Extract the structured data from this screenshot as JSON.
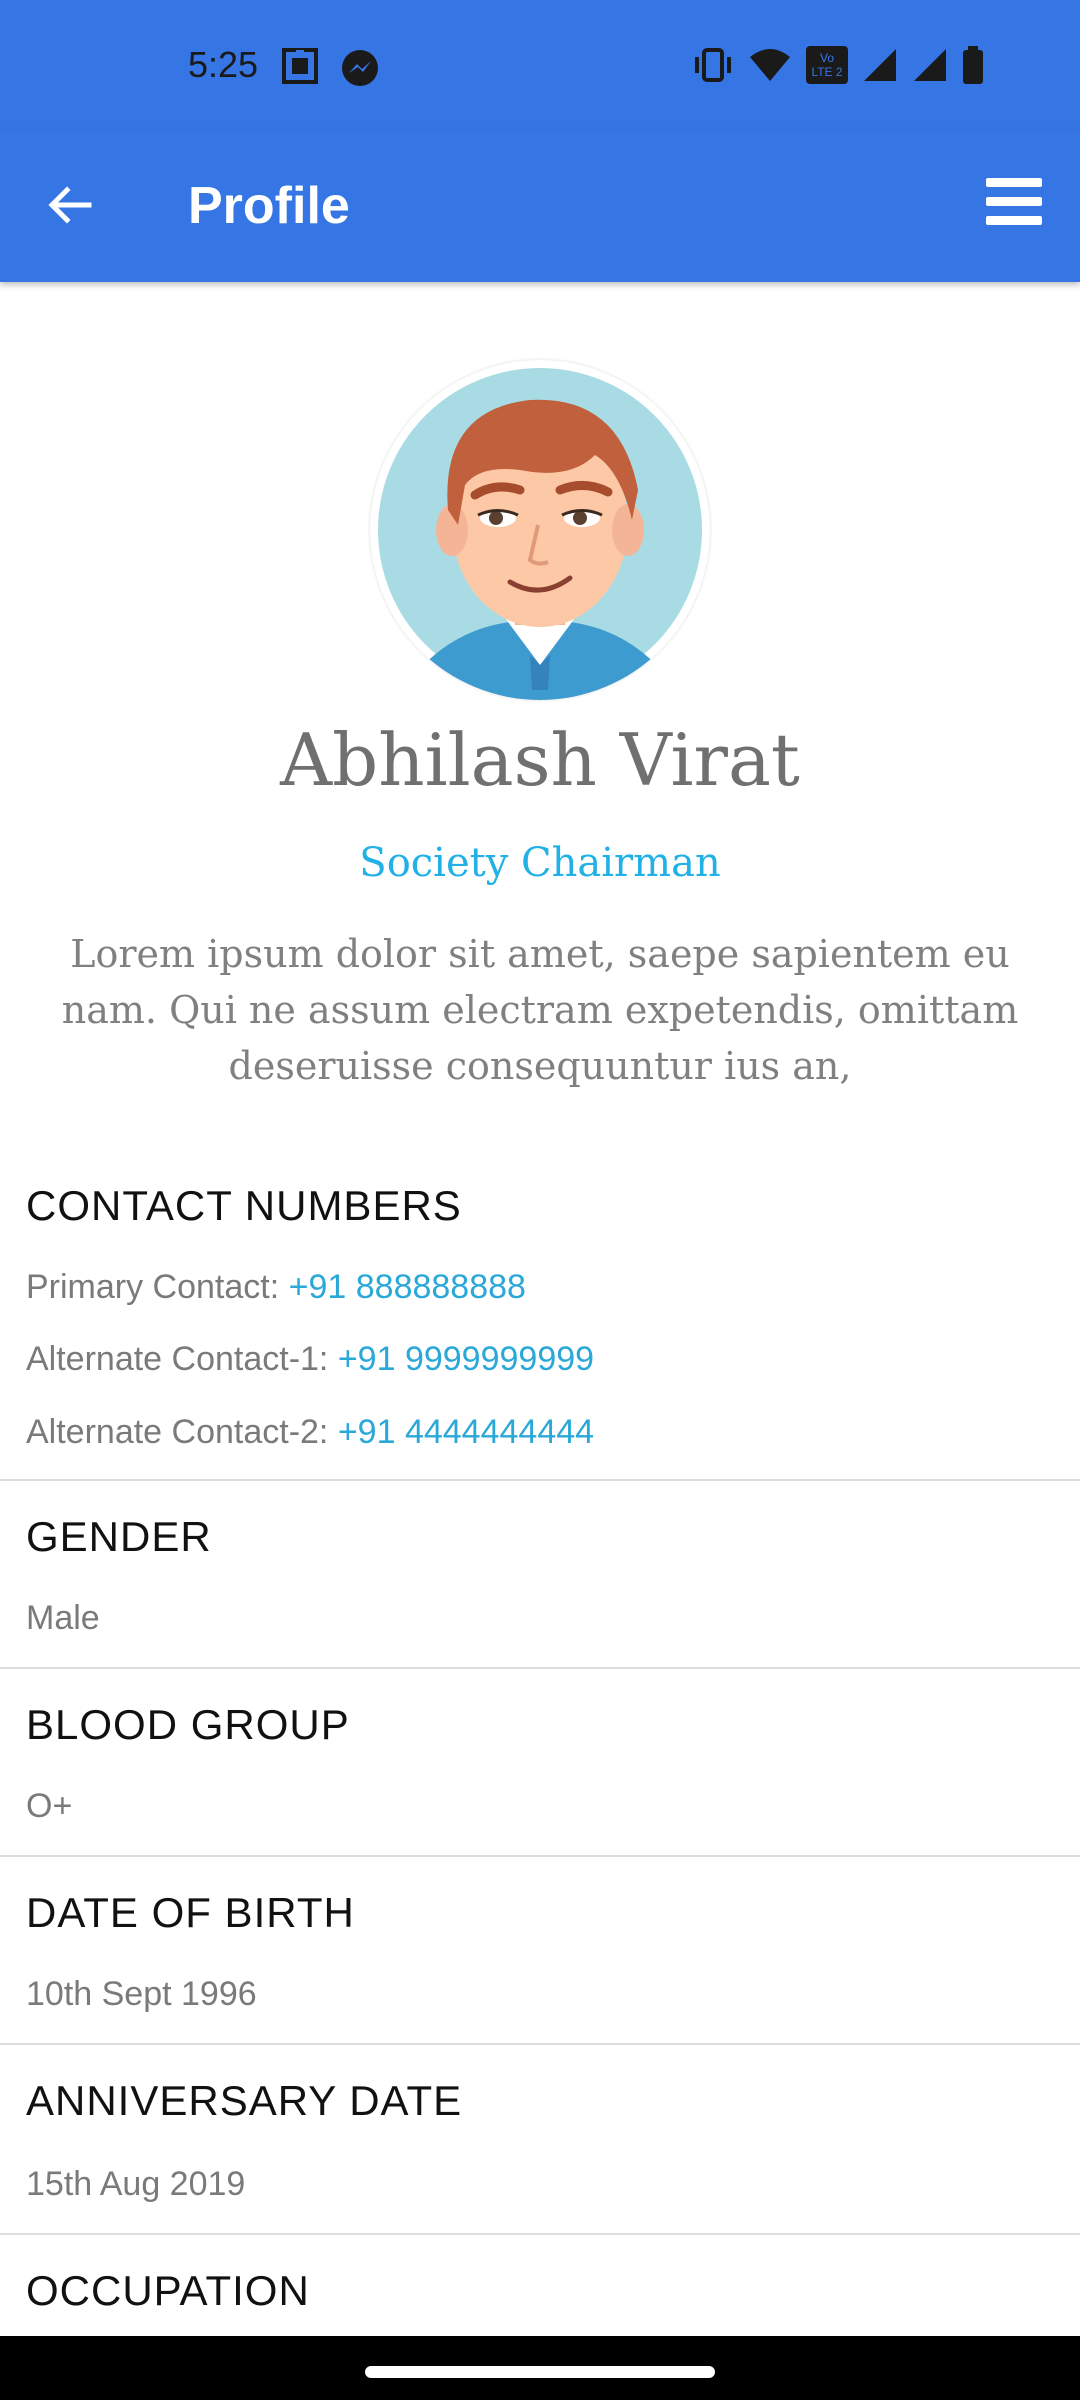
{
  "status_bar": {
    "time": "5:25",
    "lte_label_top": "Vo",
    "lte_label_bottom": "LTE 2"
  },
  "app_bar": {
    "title": "Profile",
    "back_icon": "arrow-left-icon",
    "menu_icon": "hamburger-menu-icon"
  },
  "profile": {
    "name": "Abhilash Virat",
    "role": "Society Chairman",
    "bio": "Lorem ipsum dolor sit amet, saepe sapientem eu nam. Qui ne assum electram expetendis, omittam deseruisse consequuntur ius an,"
  },
  "contact": {
    "title": "CONTACT NUMBERS",
    "primary_label": "Primary Contact: ",
    "primary_value": "+91 888888888",
    "alt1_label": "Alternate Contact-1: ",
    "alt1_value": "+91 9999999999",
    "alt2_label": "Alternate Contact-2: ",
    "alt2_value": "+91 4444444444"
  },
  "gender": {
    "title": "GENDER",
    "value": "Male"
  },
  "blood_group": {
    "title": "BLOOD GROUP",
    "value": "O+"
  },
  "dob": {
    "title": "DATE OF BIRTH",
    "value": "10th Sept 1996"
  },
  "anniversary": {
    "title": "ANNIVERSARY DATE",
    "value": "15th Aug 2019"
  },
  "occupation": {
    "title": "OCCUPATION"
  },
  "colors": {
    "primary": "#3676e4",
    "accent": "#22b1e6",
    "link": "#2aa8d8"
  }
}
